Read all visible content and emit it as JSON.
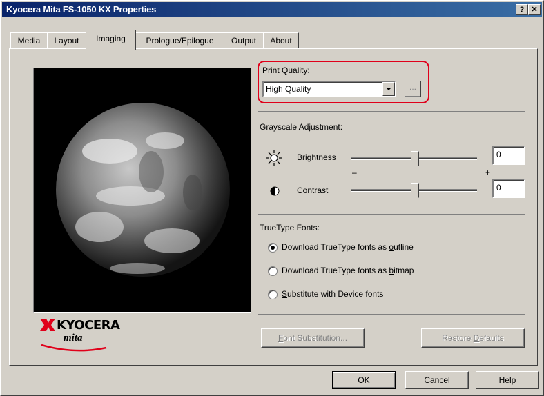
{
  "window": {
    "title": "Kyocera Mita FS-1050 KX Properties",
    "help_glyph": "?",
    "close_glyph": "✕"
  },
  "tabs": [
    {
      "label": "Media"
    },
    {
      "label": "Layout"
    },
    {
      "label": "Imaging",
      "active": true
    },
    {
      "label": "Prologue/Epilogue"
    },
    {
      "label": "Output"
    },
    {
      "label": "About"
    }
  ],
  "print_quality": {
    "label": "Print Quality:",
    "selected": "High Quality",
    "ellipsis_label": "...",
    "highlight_color": "#e0001a"
  },
  "grayscale": {
    "label": "Grayscale Adjustment:",
    "brightness": {
      "label": "Brightness",
      "value": "0",
      "icon": "sun-icon"
    },
    "contrast": {
      "label": "Contrast",
      "value": "0",
      "icon": "half-circle-icon"
    },
    "minus_mark": "–",
    "plus_mark": "+"
  },
  "truetype": {
    "label": "TrueType Fonts:",
    "options": [
      {
        "pre": "Download TrueType fonts as ",
        "key": "o",
        "post": "utline",
        "checked": true
      },
      {
        "pre": "Download TrueType fonts as ",
        "key": "b",
        "post": "itmap",
        "checked": false
      },
      {
        "pre": "",
        "key": "S",
        "post": "ubstitute with Device fonts",
        "checked": false
      }
    ]
  },
  "buttons": {
    "font_sub_key": "F",
    "font_sub_rest": "ont Substitution...",
    "restore_pre": "Restore ",
    "restore_key": "D",
    "restore_post": "efaults",
    "ok": "OK",
    "cancel": "Cancel",
    "help": "Help"
  },
  "logo": {
    "brand": "KYOCERA",
    "sub": "mita"
  }
}
